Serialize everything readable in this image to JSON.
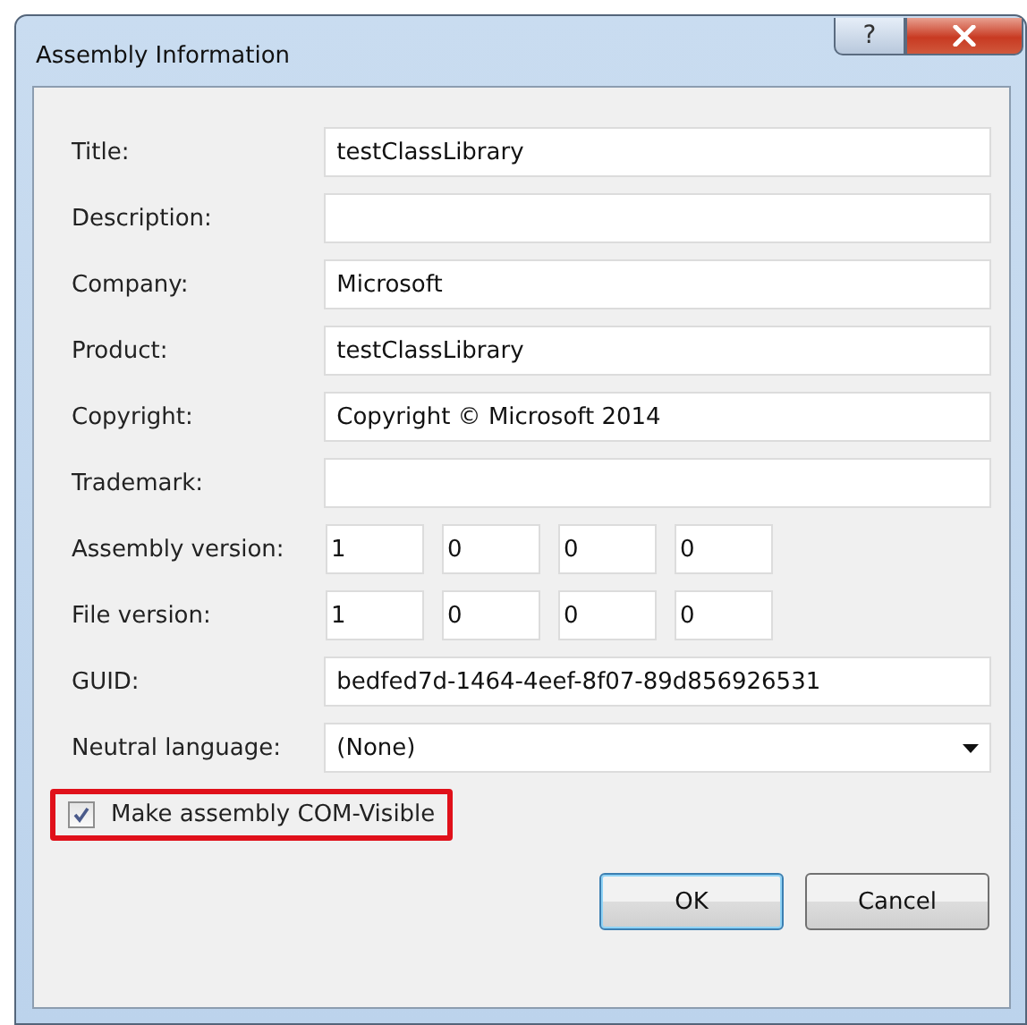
{
  "window": {
    "title": "Assembly Information",
    "help_button": "?"
  },
  "fields": [
    {
      "kind": "text",
      "label": "Title:",
      "value": "testClassLibrary"
    },
    {
      "kind": "text",
      "label": "Description:"
    },
    {
      "kind": "text",
      "label": "Company:",
      "value": "Microsoft"
    },
    {
      "kind": "text",
      "label": "Product:",
      "value": "testClassLibrary"
    },
    {
      "kind": "text",
      "label": "Copyright:",
      "value": "Copyright © Microsoft 2014"
    },
    {
      "kind": "text",
      "label": "Trademark:"
    },
    {
      "kind": "version",
      "label": "Assembly version:",
      "values": [
        "1",
        "0",
        "0",
        "0"
      ]
    },
    {
      "kind": "version",
      "label": "File version:",
      "values": [
        "1",
        "0",
        "0",
        "0"
      ]
    },
    {
      "kind": "text",
      "label": "GUID:",
      "value": "bedfed7d-1464-4eef-8f07-89d856926531"
    },
    {
      "kind": "dropdown",
      "label": "Neutral language:",
      "value": "(None)"
    }
  ],
  "checkbox": {
    "label": "Make assembly COM-Visible",
    "checked": true,
    "highlighted": true
  },
  "buttons": [
    {
      "label": "OK",
      "default": true
    },
    {
      "label": "Cancel",
      "default": false
    }
  ]
}
